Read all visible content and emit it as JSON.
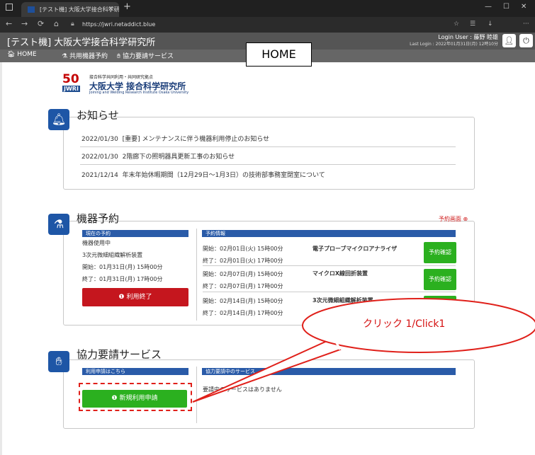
{
  "browser": {
    "tab_title": "[テスト機] 大阪大学接合科学研究",
    "url": "https://jwri.netaddict.blue"
  },
  "header": {
    "site_title": "[テスト機] 大阪大学接合科学研究所",
    "login_user": "Login User : 藤野 睦雄",
    "last_login": "Last Login : 2022年01月31日(月) 12時10分"
  },
  "menu": {
    "home": "HOME",
    "equipment": "共用機器予約",
    "cooperation": "協力要請サービス"
  },
  "annotation": {
    "home_callout": "HOME",
    "click_callout": "クリック 1/Click1"
  },
  "logo": {
    "number": "50",
    "mark": "JWRI",
    "line1": "接合科学共同利用・共同研究拠点",
    "line2": "大阪大学 接合科学研究所",
    "line3": "Joining and Welding Research Institute Osaka University"
  },
  "news": {
    "title": "お知らせ",
    "items": [
      {
        "date": "2022/01/30",
        "text": "[重要] メンテナンスに伴う機器利用停止のお知らせ"
      },
      {
        "date": "2022/01/30",
        "text": "2階廊下の照明器具更新工事のお知らせ"
      },
      {
        "date": "2021/12/14",
        "text": "年末年始休暇期間（12月29日～1月3日）の技術部事務室閉室について"
      }
    ]
  },
  "equipment": {
    "title": "機器予約",
    "reserve_link": "予約画面",
    "current_header": "現在の予約",
    "current_status": "機器使用中",
    "current_device": "3次元微細組織解析装置",
    "current_start": "開始：01月31日(月) 15時00分",
    "current_end": "終了：01月31日(月) 17時00分",
    "end_button": "利用終了",
    "reservations_header": "予約情報",
    "confirm_label": "予約確認",
    "reservations": [
      {
        "start": "開始：02月01日(火) 15時00分",
        "end": "終了：02月01日(火) 17時00分",
        "device": "電子プローブマイクロアナライザ"
      },
      {
        "start": "開始：02月07日(月) 15時00分",
        "end": "終了：02月07日(月) 17時00分",
        "device": "マイクロX線回折装置"
      },
      {
        "start": "開始：02月14日(月) 15時00分",
        "end": "終了：02月14日(月) 17時00分",
        "device": "3次元微細組織解析装置"
      }
    ]
  },
  "cooperation": {
    "title": "協力要請サービス",
    "apply_header": "利用申請はこちら",
    "inuse_header": "協力要請中のサービス",
    "empty_text": "要請中のサービスはありません",
    "new_button": "新規利用申請"
  }
}
